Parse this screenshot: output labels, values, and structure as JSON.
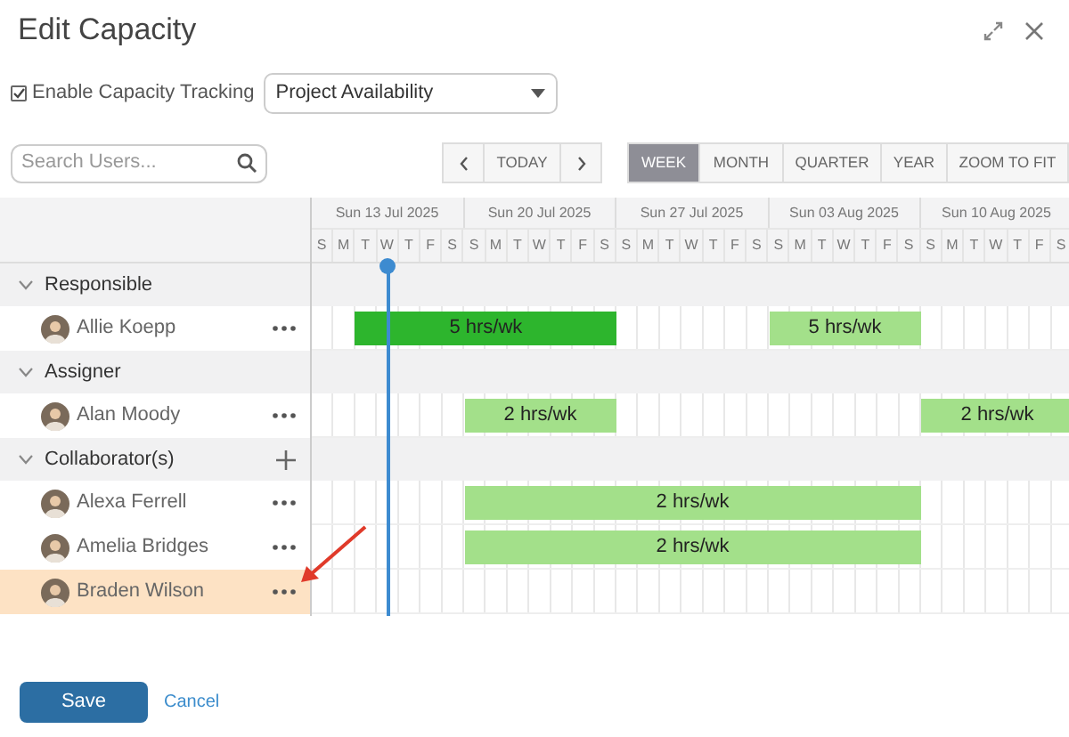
{
  "window": {
    "title": "Edit Capacity"
  },
  "tracking": {
    "label": "Enable Capacity Tracking",
    "checked": true
  },
  "mode_select": {
    "value": "Project Availability"
  },
  "search": {
    "placeholder": "Search Users..."
  },
  "nav": {
    "today": "TODAY"
  },
  "views": [
    {
      "label": "WEEK",
      "selected": true
    },
    {
      "label": "MONTH",
      "selected": false
    },
    {
      "label": "QUARTER",
      "selected": false
    },
    {
      "label": "YEAR",
      "selected": false
    },
    {
      "label": "ZOOM TO FIT",
      "selected": false
    }
  ],
  "timeline": {
    "weeks": [
      {
        "label": "Sun 13 Jul 2025",
        "days": [
          "S",
          "M",
          "T",
          "W",
          "T",
          "F",
          "S"
        ]
      },
      {
        "label": "Sun 20 Jul 2025",
        "days": [
          "S",
          "M",
          "T",
          "W",
          "T",
          "F",
          "S"
        ]
      },
      {
        "label": "Sun 27 Jul 2025",
        "days": [
          "S",
          "M",
          "T",
          "W",
          "T",
          "F",
          "S"
        ]
      },
      {
        "label": "Sun 03 Aug 2025",
        "days": [
          "S",
          "M",
          "T",
          "W",
          "T",
          "F",
          "S"
        ]
      },
      {
        "label": "Sun 10 Aug 2025",
        "days": [
          "S",
          "M",
          "T",
          "W",
          "T",
          "F",
          "S"
        ]
      }
    ]
  },
  "groups": [
    {
      "label": "Responsible",
      "expanded": true,
      "add_button": false,
      "members": [
        {
          "name": "Allie Koepp",
          "selected": false,
          "bars": [
            {
              "label": "5 hrs/wk",
              "color": "#2db52d"
            },
            {
              "label": "5 hrs/wk",
              "color": "#a3e08a"
            }
          ]
        }
      ]
    },
    {
      "label": "Assigner",
      "expanded": true,
      "add_button": false,
      "members": [
        {
          "name": "Alan Moody",
          "selected": false,
          "bars": [
            {
              "label": "2 hrs/wk",
              "color": "#a3e08a"
            },
            {
              "label": "2 hrs/wk",
              "color": "#a3e08a"
            }
          ]
        }
      ]
    },
    {
      "label": "Collaborator(s)",
      "expanded": true,
      "add_button": true,
      "members": [
        {
          "name": "Alexa Ferrell",
          "selected": false,
          "bars": [
            {
              "label": "2 hrs/wk",
              "color": "#a3e08a"
            }
          ]
        },
        {
          "name": "Amelia Bridges",
          "selected": false,
          "bars": [
            {
              "label": "2 hrs/wk",
              "color": "#a3e08a"
            }
          ]
        },
        {
          "name": "Braden Wilson",
          "selected": true
        }
      ]
    }
  ],
  "footer": {
    "save": "Save",
    "cancel": "Cancel"
  }
}
